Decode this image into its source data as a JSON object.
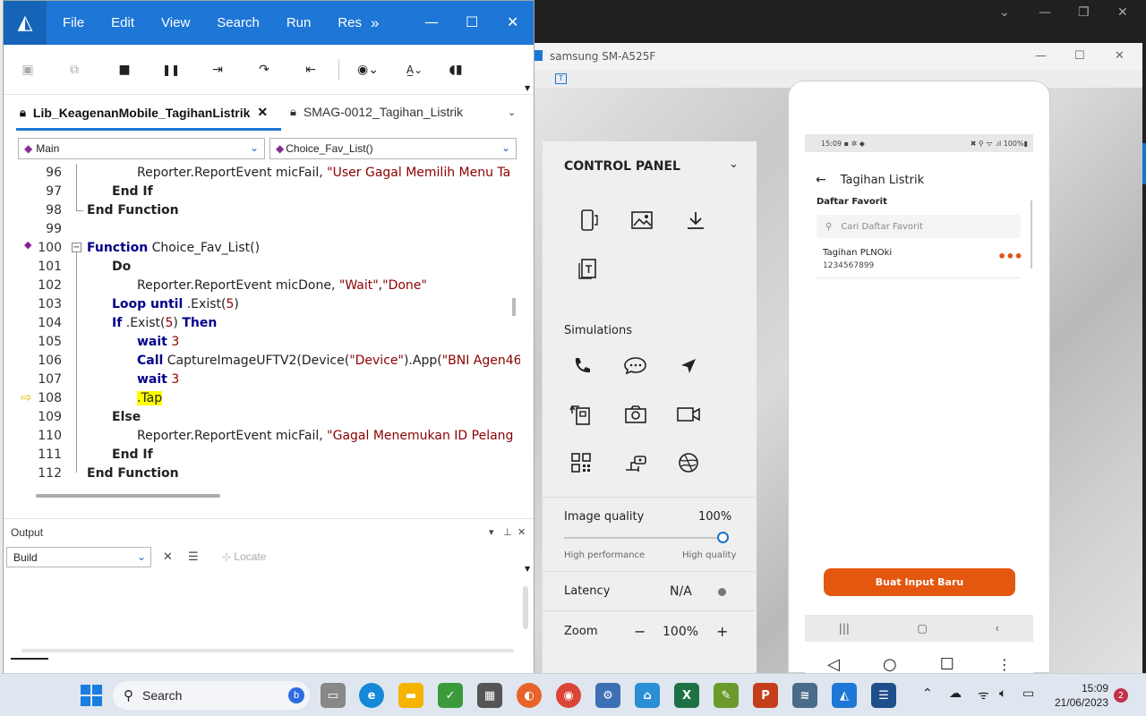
{
  "uft": {
    "menu": [
      "File",
      "Edit",
      "View",
      "Search",
      "Run",
      "Res"
    ],
    "tabs": [
      {
        "label": "Lib_KeagenanMobile_TagihanListrik"
      },
      {
        "label": "SMAG-0012_Tagihan_Listrik"
      }
    ],
    "dropdown_left": "Main",
    "dropdown_right": "Choice_Fav_List()",
    "code_lines": [
      {
        "num": "96"
      },
      {
        "num": "97"
      },
      {
        "num": "98"
      },
      {
        "num": "99"
      },
      {
        "num": "100"
      },
      {
        "num": "101"
      },
      {
        "num": "102"
      },
      {
        "num": "103"
      },
      {
        "num": "104"
      },
      {
        "num": "105"
      },
      {
        "num": "106"
      },
      {
        "num": "107"
      },
      {
        "num": "108"
      },
      {
        "num": "109"
      },
      {
        "num": "110"
      },
      {
        "num": "111"
      },
      {
        "num": "112"
      }
    ],
    "code": {
      "l96_a": "Reporter.ReportEvent micFail, ",
      "l96_b": "\"User Gagal Memilih Menu Ta",
      "l97": "End If",
      "l98": "End Function",
      "l100_kw": "Function",
      "l100_rest": " Choice_Fav_List()",
      "l101": "Do",
      "l102_a": "Reporter.ReportEvent micDone, ",
      "l102_b": "\"Wait\"",
      "l102_c": ",",
      "l102_d": "\"Done\"",
      "l103_kw": "Loop until",
      ".l103_a": "",
      "l103_rest": " .Exist(",
      "l103_num": "5",
      "l103_end": ")",
      "l104_kw": "If",
      " l104_a": "",
      "l104_rest": " .Exist(",
      "l104_num": "5",
      "l104_end": ") ",
      "l104_kw2": "Then",
      "l105_kw": "wait",
      "l105_num": " 3",
      "l106_kw": "Call",
      "l106_rest": " CaptureImageUFTV2(Device(",
      "l106_s1": "\"Device\"",
      "l106_r2": ").App(",
      "l106_s2": "\"BNI Agen46",
      "l107_kw": "wait",
      "l107_num": " 3",
      "l108": ".Tap",
      "l109": "Else",
      "l110_a": "Reporter.ReportEvent micFail, ",
      "l110_b": "\"Gagal Menemukan ID Pelang",
      "l111": "End If",
      "l112": "End Function"
    },
    "output": {
      "title": "Output",
      "build": "Build",
      "locate": "Locate"
    }
  },
  "samsung": {
    "title": "samsung SM-A525F",
    "control_panel": {
      "title": "CONTROL PANEL",
      "simulations": "Simulations",
      "image_quality": "Image quality",
      "image_quality_value": "100%",
      "image_quality_level": 1.0,
      "high_performance": "High performance",
      "high_quality": "High quality",
      "latency": "Latency",
      "latency_value": "N/A",
      "zoom": "Zoom",
      "zoom_value": "100%",
      "zoom_minus": "−",
      "zoom_plus": "+"
    },
    "phone": {
      "status_time": "15:09 ▪ ✲ ◆",
      "status_right": "✖ ⚲ ᯤ .ıl 100%▮",
      "title": "Tagihan Listrik",
      "section": "Daftar Favorit",
      "search_placeholder": "Cari Daftar Favorit",
      "item_name": "Tagihan PLNOki",
      "item_id": "1234567899",
      "button": "Buat Input Baru"
    }
  },
  "taskbar": {
    "search": "Search",
    "time": "15:09",
    "date": "21/06/2023",
    "notifications": "2"
  },
  "colors": {
    "uft_blue": "#1e76d6",
    "phone_orange": "#e4570f",
    "keyword": "#00008b",
    "string": "#8b0000"
  }
}
